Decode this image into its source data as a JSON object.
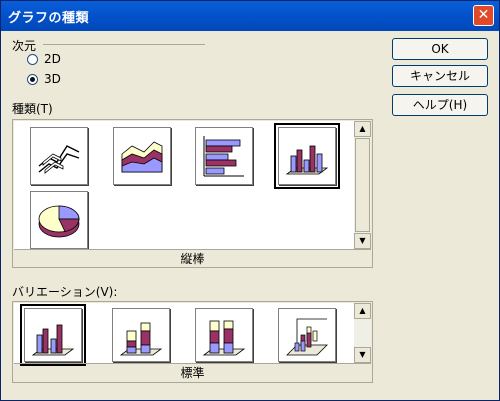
{
  "window": {
    "title": "グラフの種類"
  },
  "dimension": {
    "label": "次元",
    "options": [
      {
        "label": "2D",
        "checked": false
      },
      {
        "label": "3D",
        "checked": true
      }
    ]
  },
  "chart_type": {
    "label": "種類(T)",
    "items": [
      {
        "icon": "3d-line-chart-icon"
      },
      {
        "icon": "3d-area-chart-icon"
      },
      {
        "icon": "3d-horizontal-bar-chart-icon"
      },
      {
        "icon": "3d-column-chart-icon",
        "selected": true
      },
      {
        "icon": "3d-pie-chart-icon"
      }
    ],
    "caption": "縦棒"
  },
  "variation": {
    "label": "バリエーション(V):",
    "items": [
      {
        "icon": "3d-column-normal-icon",
        "selected": true
      },
      {
        "icon": "3d-column-stacked-icon"
      },
      {
        "icon": "3d-column-percent-stacked-icon"
      },
      {
        "icon": "3d-column-deep-icon"
      }
    ],
    "caption": "標準"
  },
  "buttons": {
    "ok": "OK",
    "cancel": "キャンセル",
    "help": "ヘルプ(H)"
  },
  "colors": {
    "title_bar": "#0352cc",
    "dialog_bg": "#ece9d8",
    "series_purple": "#9999ff",
    "series_maroon": "#993366",
    "series_cream": "#ffffcc"
  }
}
